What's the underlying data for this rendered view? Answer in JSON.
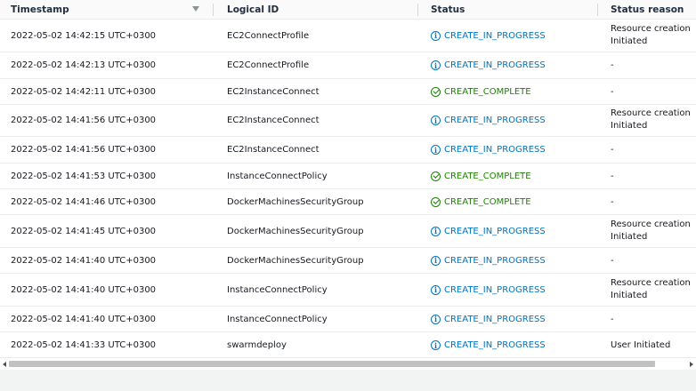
{
  "columns": {
    "timestamp": "Timestamp",
    "logical_id": "Logical ID",
    "status": "Status",
    "status_reason": "Status reason"
  },
  "rows": [
    {
      "timestamp": "2022-05-02 14:42:15 UTC+0300",
      "logical_id": "EC2ConnectProfile",
      "status": "CREATE_IN_PROGRESS",
      "status_kind": "info",
      "reason": "Resource creation Initiated"
    },
    {
      "timestamp": "2022-05-02 14:42:13 UTC+0300",
      "logical_id": "EC2ConnectProfile",
      "status": "CREATE_IN_PROGRESS",
      "status_kind": "info",
      "reason": "-"
    },
    {
      "timestamp": "2022-05-02 14:42:11 UTC+0300",
      "logical_id": "EC2InstanceConnect",
      "status": "CREATE_COMPLETE",
      "status_kind": "ok",
      "reason": "-"
    },
    {
      "timestamp": "2022-05-02 14:41:56 UTC+0300",
      "logical_id": "EC2InstanceConnect",
      "status": "CREATE_IN_PROGRESS",
      "status_kind": "info",
      "reason": "Resource creation Initiated"
    },
    {
      "timestamp": "2022-05-02 14:41:56 UTC+0300",
      "logical_id": "EC2InstanceConnect",
      "status": "CREATE_IN_PROGRESS",
      "status_kind": "info",
      "reason": "-"
    },
    {
      "timestamp": "2022-05-02 14:41:53 UTC+0300",
      "logical_id": "InstanceConnectPolicy",
      "status": "CREATE_COMPLETE",
      "status_kind": "ok",
      "reason": "-"
    },
    {
      "timestamp": "2022-05-02 14:41:46 UTC+0300",
      "logical_id": "DockerMachinesSecurityGroup",
      "status": "CREATE_COMPLETE",
      "status_kind": "ok",
      "reason": "-"
    },
    {
      "timestamp": "2022-05-02 14:41:45 UTC+0300",
      "logical_id": "DockerMachinesSecurityGroup",
      "status": "CREATE_IN_PROGRESS",
      "status_kind": "info",
      "reason": "Resource creation Initiated"
    },
    {
      "timestamp": "2022-05-02 14:41:40 UTC+0300",
      "logical_id": "DockerMachinesSecurityGroup",
      "status": "CREATE_IN_PROGRESS",
      "status_kind": "info",
      "reason": "-"
    },
    {
      "timestamp": "2022-05-02 14:41:40 UTC+0300",
      "logical_id": "InstanceConnectPolicy",
      "status": "CREATE_IN_PROGRESS",
      "status_kind": "info",
      "reason": "Resource creation Initiated"
    },
    {
      "timestamp": "2022-05-02 14:41:40 UTC+0300",
      "logical_id": "InstanceConnectPolicy",
      "status": "CREATE_IN_PROGRESS",
      "status_kind": "info",
      "reason": "-"
    },
    {
      "timestamp": "2022-05-02 14:41:33 UTC+0300",
      "logical_id": "swarmdeploy",
      "status": "CREATE_IN_PROGRESS",
      "status_kind": "info",
      "reason": "User Initiated"
    }
  ],
  "colors": {
    "info": "#0073bb",
    "complete": "#1d8102",
    "header_bg": "#fafafa",
    "divider": "#eaeded"
  },
  "icons": {
    "info": "info-circle-icon",
    "ok": "check-circle-icon",
    "sort": "sort-down-icon"
  }
}
